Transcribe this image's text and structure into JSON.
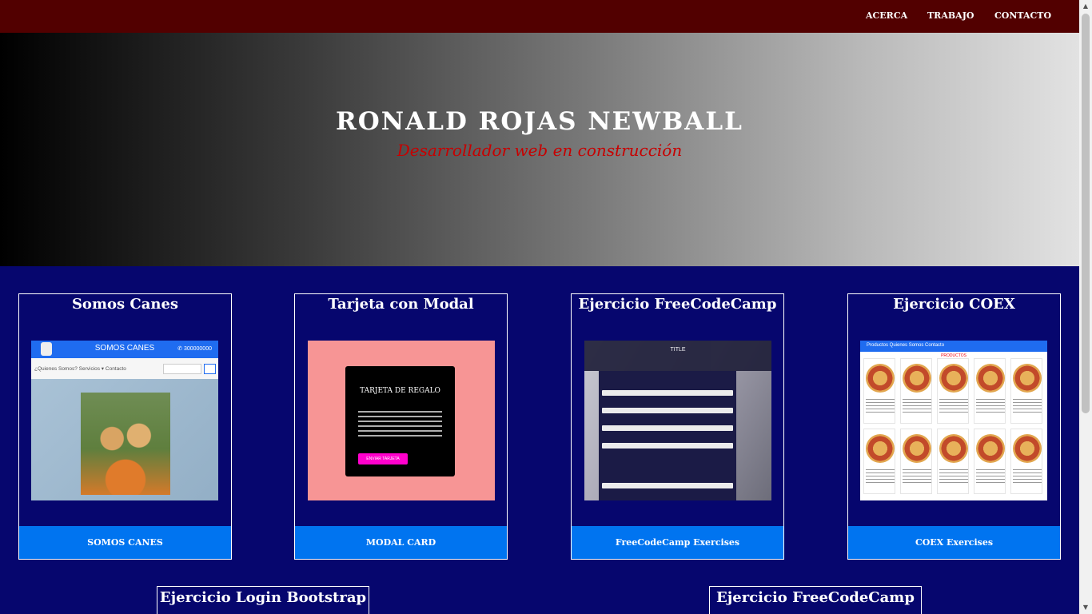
{
  "nav": {
    "links": [
      "ACERCA",
      "TRABAJO",
      "CONTACTO"
    ]
  },
  "hero": {
    "title": "RONALD ROJAS NEWBALL",
    "subtitle": "Desarrollador web en construcción"
  },
  "cards": [
    {
      "title": "Somos Canes",
      "button": "SOMOS CANES",
      "thumb": {
        "brand": "SOMOS CANES",
        "phone": "✆ 300000000",
        "nav": "¿Quienes Somos?  Servicios ▾  Contacto"
      }
    },
    {
      "title": "Tarjeta con Modal",
      "button": "MODAL CARD",
      "thumb": {
        "heading": "TARJETA DE REGALO",
        "button": "ENVIAR TARJETA"
      }
    },
    {
      "title": "Ejercicio FreeCodeCamp",
      "button": "FreeCodeCamp Exercises",
      "thumb": {
        "heading": "TITLE"
      }
    },
    {
      "title": "Ejercicio COEX",
      "button": "COEX Exercises",
      "thumb": {
        "nav": "Productos   Quienes Somos   Contacto",
        "heading": "PRODUCTOS"
      }
    }
  ],
  "cards_row2": [
    {
      "title": "Ejercicio Login Bootstrap"
    },
    {
      "title": "Ejercicio FreeCodeCamp"
    }
  ],
  "colors": {
    "navbar": "#520000",
    "page_bg": "#06066e",
    "button_bg": "#0074f0",
    "subtitle": "#c70000"
  }
}
